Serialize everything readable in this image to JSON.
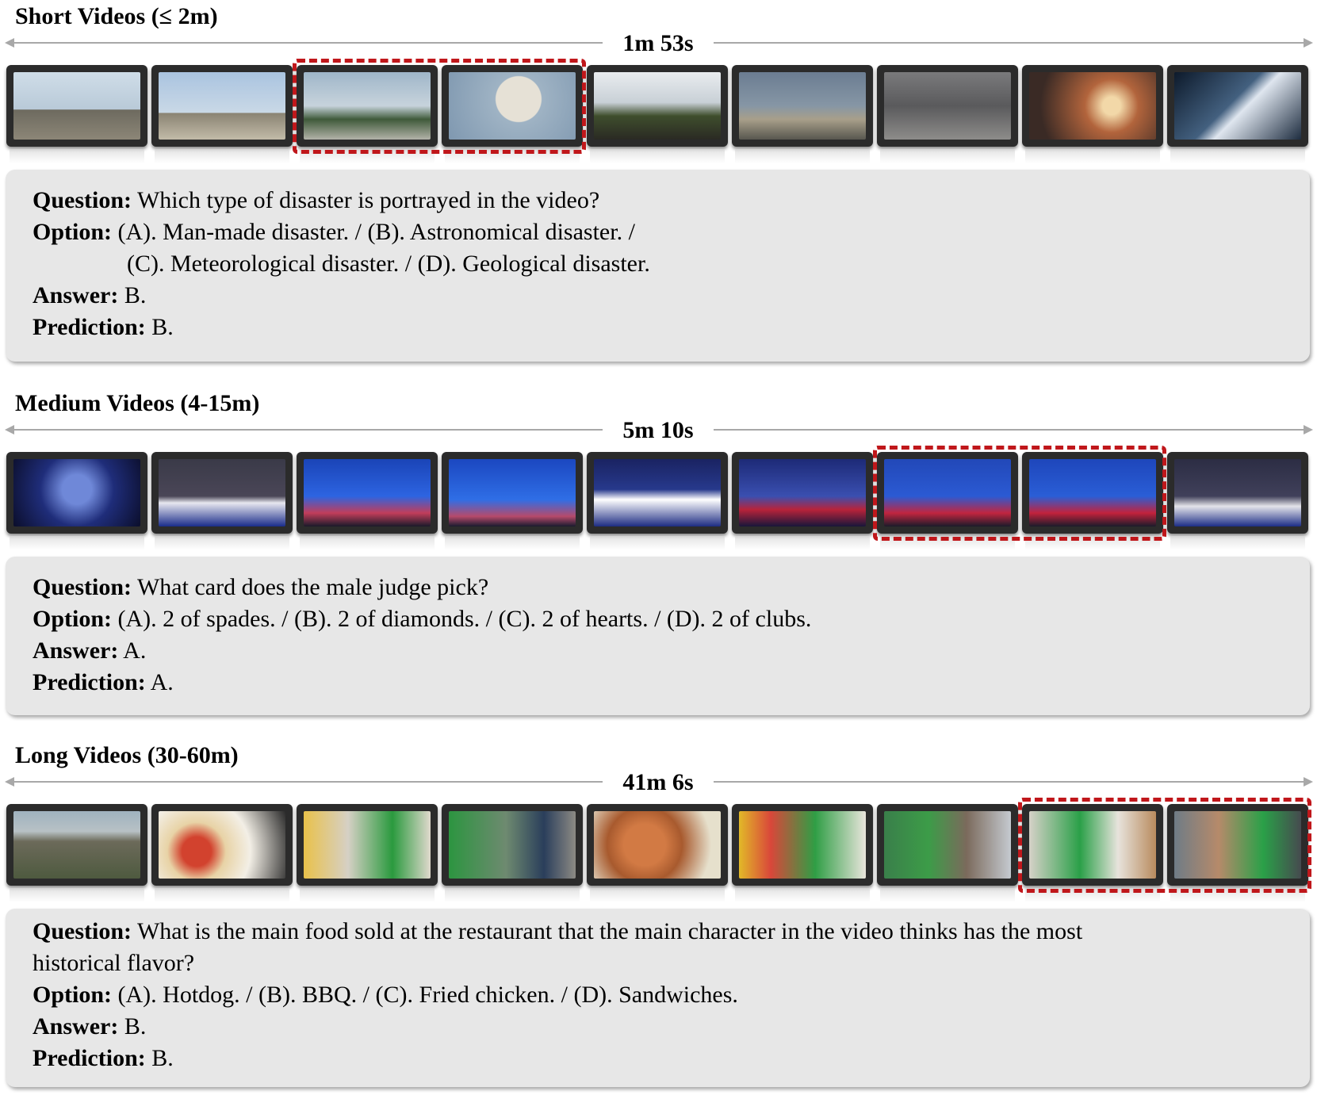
{
  "sections": [
    {
      "title": "Short Videos (≤ 2m)",
      "duration": "1m 53s",
      "question_label": "Question:",
      "question": "Which type of disaster is portrayed in the video?",
      "option_label": "Option:",
      "option_line1": "(A). Man-made disaster. / (B). Astronomical disaster. /",
      "option_line2": "(C). Meteorological disaster. / (D). Geological disaster.",
      "answer_label": "Answer:",
      "answer": "B.",
      "prediction_label": "Prediction:",
      "prediction": "B."
    },
    {
      "title": "Medium Videos (4-15m)",
      "duration": "5m 10s",
      "question_label": "Question:",
      "question": "What card does the male judge pick?",
      "option_label": "Option:",
      "option_line1": "(A). 2 of spades. / (B). 2 of diamonds. / (C). 2 of hearts. / (D). 2 of clubs.",
      "answer_label": "Answer:",
      "answer": "A.",
      "prediction_label": "Prediction:",
      "prediction": "A."
    },
    {
      "title": "Long Videos (30-60m)",
      "duration": "41m 6s",
      "question_label": "Question:",
      "question": "What is the main food sold at the restaurant that the main character in the video thinks has the most",
      "question_cont": "historical flavor?",
      "option_label": "Option:",
      "option_line1": "(A). Hotdog. / (B). BBQ. / (C). Fried chicken. / (D). Sandwiches.",
      "answer_label": "Answer:",
      "answer": "B.",
      "prediction_label": "Prediction:",
      "prediction": "B."
    }
  ],
  "colors": {
    "highlight": "#c0171b",
    "qa_background": "#e7e7e7",
    "frame_border": "#2b2b2b"
  }
}
